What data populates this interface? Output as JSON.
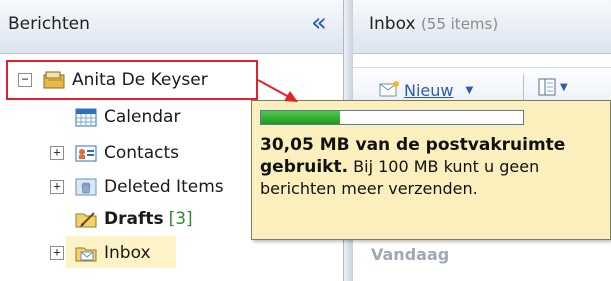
{
  "left_pane": {
    "title": "Berichten",
    "collapse_glyph": "«",
    "account": "Anita De Keyser",
    "folders": [
      {
        "label": "Calendar",
        "expander": ""
      },
      {
        "label": "Contacts",
        "expander": "+"
      },
      {
        "label": "Deleted Items",
        "expander": "+"
      },
      {
        "label": "Drafts",
        "count": "[3]",
        "expander": ""
      },
      {
        "label": "Inbox",
        "expander": "+"
      }
    ],
    "account_expander": "−"
  },
  "right_pane": {
    "title": "Inbox",
    "item_count": "(55 items)",
    "new_button": "Nieuw",
    "group_heading": "Vandaag"
  },
  "tooltip": {
    "quota_used_fraction": 0.3005,
    "bold_text": "30,05 MB van de postvakruimte gebruikt.",
    "normal_text": " Bij 100 MB kunt u geen berichten meer verzenden."
  },
  "colors": {
    "highlight_border": "#e0232b",
    "tooltip_bg": "#fbf0bd",
    "quota_fill": "#1d9a1d",
    "link_blue": "#2a5db0"
  }
}
